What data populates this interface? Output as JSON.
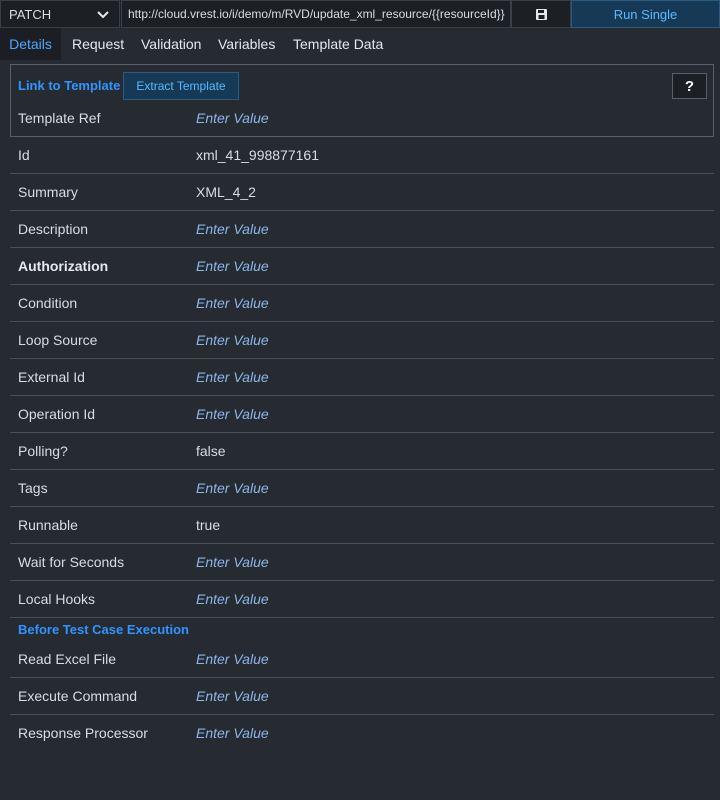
{
  "toolbar": {
    "method": "PATCH",
    "url": "http://cloud.vrest.io/i/demo/m/RVD/update_xml_resource/{{resourceId}}",
    "save_icon": "floppy-disk-icon",
    "run_label": "Run Single"
  },
  "tabs": [
    {
      "label": "Details"
    },
    {
      "label": "Request"
    },
    {
      "label": "Validation"
    },
    {
      "label": "Variables"
    },
    {
      "label": "Template Data"
    }
  ],
  "template": {
    "link_label": "Link to Template",
    "extract_label": "Extract Template",
    "help_label": "?",
    "ref_label": "Template Ref",
    "ref_value": "Enter Value"
  },
  "fields": [
    {
      "label": "Id",
      "value": "xml_41_998877161"
    },
    {
      "label": "Summary",
      "value": "XML_4_2"
    },
    {
      "label": "Description",
      "value": "Enter Value"
    },
    {
      "label": "Authorization",
      "value": "Enter Value"
    },
    {
      "label": "Condition",
      "value": "Enter Value"
    },
    {
      "label": "Loop Source",
      "value": "Enter Value"
    },
    {
      "label": "External Id",
      "value": "Enter Value"
    },
    {
      "label": "Operation Id",
      "value": "Enter Value"
    },
    {
      "label": "Polling?",
      "value": "false"
    },
    {
      "label": "Tags",
      "value": "Enter Value"
    },
    {
      "label": "Runnable",
      "value": "true"
    },
    {
      "label": "Wait for Seconds",
      "value": "Enter Value"
    },
    {
      "label": "Local Hooks",
      "value": "Enter Value"
    }
  ],
  "before_section": {
    "title": "Before Test Case Execution",
    "fields": [
      {
        "label": "Read Excel File",
        "value": "Enter Value"
      },
      {
        "label": "Execute Command",
        "value": "Enter Value"
      },
      {
        "label": "Response Processor",
        "value": "Enter Value"
      }
    ]
  },
  "colors": {
    "accent": "#2f95ff",
    "placeholder": "#8ab6ea",
    "background": "#262a31"
  }
}
